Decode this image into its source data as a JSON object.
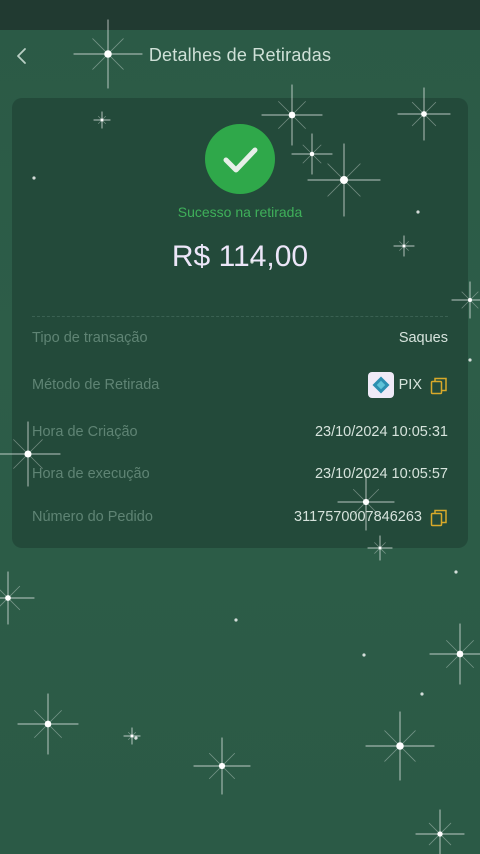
{
  "header": {
    "title": "Detalhes de Retiradas",
    "back_icon": "chevron-left-icon"
  },
  "status": {
    "icon": "check-circle-icon",
    "text": "Sucesso na retirada",
    "amount": "R$ 114,00",
    "accent_color": "#2fa84a"
  },
  "details": {
    "transaction_type": {
      "label": "Tipo de transação",
      "value": "Saques"
    },
    "withdrawal_method": {
      "label": "Método de Retirada",
      "value": "PIX",
      "icon": "pix-icon"
    },
    "created_at": {
      "label": "Hora de Criação",
      "value": "23/10/2024 10:05:31"
    },
    "executed_at": {
      "label": "Hora de execução",
      "value": "23/10/2024 10:05:57"
    },
    "order_number": {
      "label": "Número do Pedido",
      "value": "3117570007846263"
    }
  },
  "colors": {
    "background": "#2b5a46",
    "card": "#234a3a",
    "copy_icon": "#d8a92a"
  }
}
